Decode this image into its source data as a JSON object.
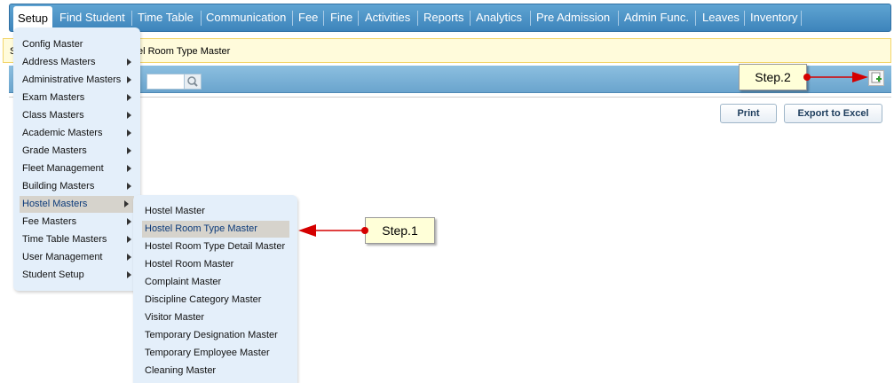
{
  "nav": {
    "items": [
      "Setup",
      "Find Student",
      "Time Table",
      "Communication",
      "Fee",
      "Fine",
      "Activities",
      "Reports",
      "Analytics",
      "Pre Admission",
      "Admin Func.",
      "Leaves",
      "Inventory"
    ]
  },
  "breadcrumb": {
    "prefix": "S",
    "text": "el Room Type Master"
  },
  "toolbar": {
    "search_icon": "magnifier-icon",
    "add_icon": "add-record-icon"
  },
  "actions": {
    "print": "Print",
    "export": "Export to Excel"
  },
  "setup_menu": {
    "items": [
      {
        "label": "Config Master",
        "submenu": false
      },
      {
        "label": "Address Masters",
        "submenu": true
      },
      {
        "label": "Administrative Masters",
        "submenu": true
      },
      {
        "label": "Exam Masters",
        "submenu": true
      },
      {
        "label": "Class Masters",
        "submenu": true
      },
      {
        "label": "Academic Masters",
        "submenu": true
      },
      {
        "label": "Grade Masters",
        "submenu": true
      },
      {
        "label": "Fleet Management",
        "submenu": true
      },
      {
        "label": "Building Masters",
        "submenu": true
      },
      {
        "label": "Hostel Masters",
        "submenu": true,
        "highlighted": true
      },
      {
        "label": "Fee Masters",
        "submenu": true
      },
      {
        "label": "Time Table Masters",
        "submenu": true
      },
      {
        "label": "User Management",
        "submenu": true
      },
      {
        "label": "Student Setup",
        "submenu": true
      }
    ]
  },
  "hostel_menu": {
    "items": [
      {
        "label": "Hostel Master"
      },
      {
        "label": "Hostel Room Type Master",
        "highlighted": true
      },
      {
        "label": "Hostel Room Type Detail Master"
      },
      {
        "label": "Hostel Room Master"
      },
      {
        "label": "Complaint Master"
      },
      {
        "label": "Discipline Category Master"
      },
      {
        "label": "Visitor Master"
      },
      {
        "label": "Temporary Designation Master"
      },
      {
        "label": "Temporary Employee Master"
      },
      {
        "label": "Cleaning Master"
      }
    ]
  },
  "callouts": {
    "step1": "Step.1",
    "step2": "Step.2"
  },
  "colors": {
    "nav_blue": "#3d84bb",
    "menu_bg": "#e4effa",
    "arrow_red": "#d50000",
    "callout_bg": "#ffffd8"
  }
}
